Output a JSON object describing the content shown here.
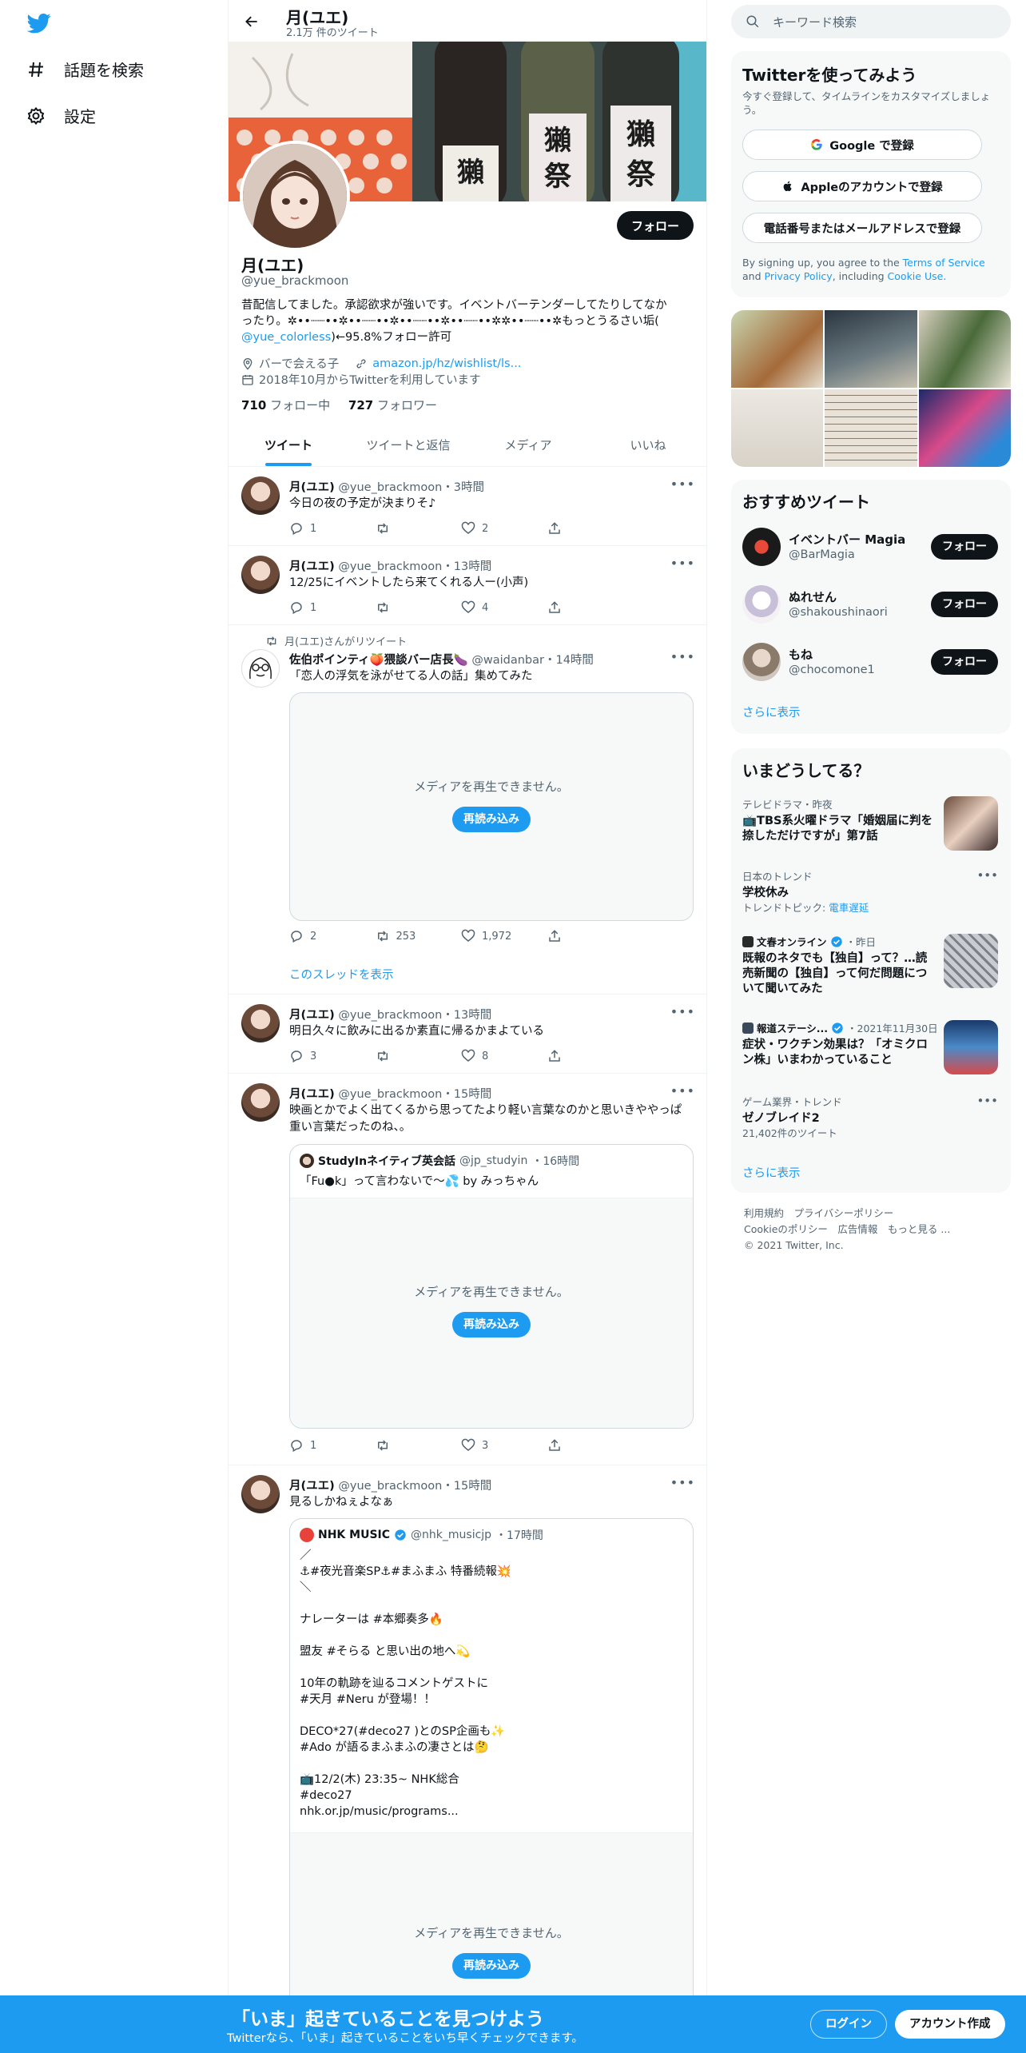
{
  "nav": {
    "explore_label": "話題を検索",
    "settings_label": "設定"
  },
  "header": {
    "name": "月(ユエ)",
    "tweet_count": "2.1万 件のツイート"
  },
  "profile": {
    "follow_label": "フォロー",
    "name": "月(ユエ)",
    "handle": "@yue_brackmoon",
    "bio_line1": "昔配信してました。承認欲求が強いです。イベントバーテンダーしてたりしてなか",
    "bio_line2": "ったり。✲••┈┈••✲••┈┈••✲••┈┈••✲••┈┈••✲✲••┈┈••✲もっとうるさい垢(",
    "bio_mention": "@yue_colorless",
    "bio_line3_suffix": ")←95.8%フォロー許可",
    "location": "バーで会える子",
    "link": "amazon.jp/hz/wishlist/ls...",
    "joined": "2018年10月からTwitterを利用しています",
    "following_count": "710",
    "following_label": "フォロー中",
    "followers_count": "727",
    "followers_label": "フォロワー"
  },
  "tabs": [
    "ツイート",
    "ツイートと返信",
    "メディア",
    "いいね"
  ],
  "tweets": [
    {
      "name": "月(ユエ)",
      "handle": "@yue_brackmoon",
      "time": "・3時間",
      "text": "今日の夜の予定が決まりそ♪",
      "replies": "1",
      "retweets": "",
      "likes": "2"
    },
    {
      "name": "月(ユエ)",
      "handle": "@yue_brackmoon",
      "time": "・13時間",
      "text": "12/25にイベントしたら来てくれる人ー(小声)",
      "replies": "1",
      "retweets": "",
      "likes": "4"
    },
    {
      "retweeted_by": "月(ユエ)さんがリツイート",
      "name": "佐伯ポインティ🍑猥談バー店長🍆",
      "handle": "@waidanbar",
      "time": "・14時間",
      "text": "「恋人の浮気を泳がせてる人の話」集めてみた",
      "media_message": "メディアを再生できません。",
      "reload_label": "再読み込み",
      "replies": "2",
      "retweets": "253",
      "likes": "1,972",
      "thread_link": "このスレッドを表示"
    },
    {
      "name": "月(ユエ)",
      "handle": "@yue_brackmoon",
      "time": "・13時間",
      "text": "明日久々に飲みに出るか素直に帰るかまよている",
      "replies": "3",
      "retweets": "",
      "likes": "8"
    },
    {
      "name": "月(ユエ)",
      "handle": "@yue_brackmoon",
      "time": "・15時間",
      "text": "映画とかでよく出てくるから思ってたより軽い言葉なのかと思いきややっぱ重い言葉だったのね、。",
      "quote_name": "StudyInネイティブ英会話",
      "quote_handle": "@jp_studyin",
      "quote_time": "・16時間",
      "quote_text": "「Fu●k」って言わないで〜💦 by みっちゃん",
      "media_message": "メディアを再生できません。",
      "reload_label": "再読み込み",
      "replies": "1",
      "retweets": "",
      "likes": "3"
    },
    {
      "name": "月(ユエ)",
      "handle": "@yue_brackmoon",
      "time": "・15時間",
      "text": "見るしかねぇよなぁ",
      "quote_name": "NHK MUSIC",
      "quote_handle": "@nhk_musicjp",
      "quote_time": "・17時間",
      "quote_text": "／\n⚓#夜光音楽SP⚓#まふまふ 特番続報💥\n＼\n\nナレーターは #本郷奏多🔥\n\n盟友 #そらる と思い出の地へ💫\n\n10年の軌跡を辿るコメントゲストに\n#天月 #Neru が登場！！\n\nDECO*27(#deco27 )とのSP企画も✨\n#Ado が語るまふまふの凄さとは🤔\n\n📺12/2(木) 23:35~ NHK総合\n#deco27\nnhk.or.jp/music/programs...",
      "media_message": "メディアを再生できません。",
      "reload_label": "再読み込み"
    }
  ],
  "sidebar": {
    "search_placeholder": "キーワード検索",
    "signup_title": "Twitterを使ってみよう",
    "signup_sub": "今すぐ登録して、タイムラインをカスタマイズしましょう。",
    "google_label": "Google で登録",
    "apple_label": "Appleのアカウントで登録",
    "phone_label": "電話番号またはメールアドレスで登録",
    "terms_prefix": "By signing up, you agree to the ",
    "terms_link": "Terms of Service",
    "terms_and": " and ",
    "privacy_link": "Privacy Policy",
    "terms_including": ", including ",
    "cookie_link": "Cookie Use.",
    "rec_title": "おすすめツイート",
    "rec_users": [
      {
        "name": "イベントバー Magia",
        "handle": "@BarMagia",
        "follow": "フォロー"
      },
      {
        "name": "ぬれせん",
        "handle": "@shakoushinaori",
        "follow": "フォロー"
      },
      {
        "name": "もね",
        "handle": "@chocomone1",
        "follow": "フォロー"
      }
    ],
    "show_more": "さらに表示",
    "trends_title": "いまどうしてる？",
    "trends": [
      {
        "meta": "テレビドラマ・昨夜",
        "title": "📺TBS系火曜ドラマ「婚姻届に判を捺しただけですが」第7話"
      },
      {
        "meta": "日本のトレンド",
        "title": "学校休み",
        "sub_prefix": "トレンドトピック: ",
        "sub_link": "電車遅延"
      },
      {
        "meta": "文春オンライン",
        "meta_time": "・昨日",
        "title": "既報のネタでも【独自】って？…読売新聞の【独自】って何だ問題について聞いてみた"
      },
      {
        "meta": "報道ステーシ...",
        "meta_time": "・2021年11月30日",
        "title": "症状・ワクチン効果は？「オミクロン株」いまわかっていること"
      },
      {
        "meta": "ゲーム業界・トレンド",
        "title": "ゼノブレイド2",
        "sub": "21,402件のツイート"
      }
    ],
    "trends_more": "さらに表示",
    "footer_line1": "利用規約　プライバシーポリシー",
    "footer_line2": "Cookieのポリシー　広告情報　もっと見る ...",
    "footer_line3": "© 2021 Twitter, Inc."
  },
  "bottombar": {
    "title": "「いま」起きていることを見つけよう",
    "subtitle": "Twitterなら、「いま」起きていることをいち早くチェックできます。",
    "login": "ログイン",
    "signup": "アカウント作成"
  },
  "colors": {
    "accent": "#1d9bf0",
    "text": "#0f1419",
    "muted": "#536471"
  }
}
